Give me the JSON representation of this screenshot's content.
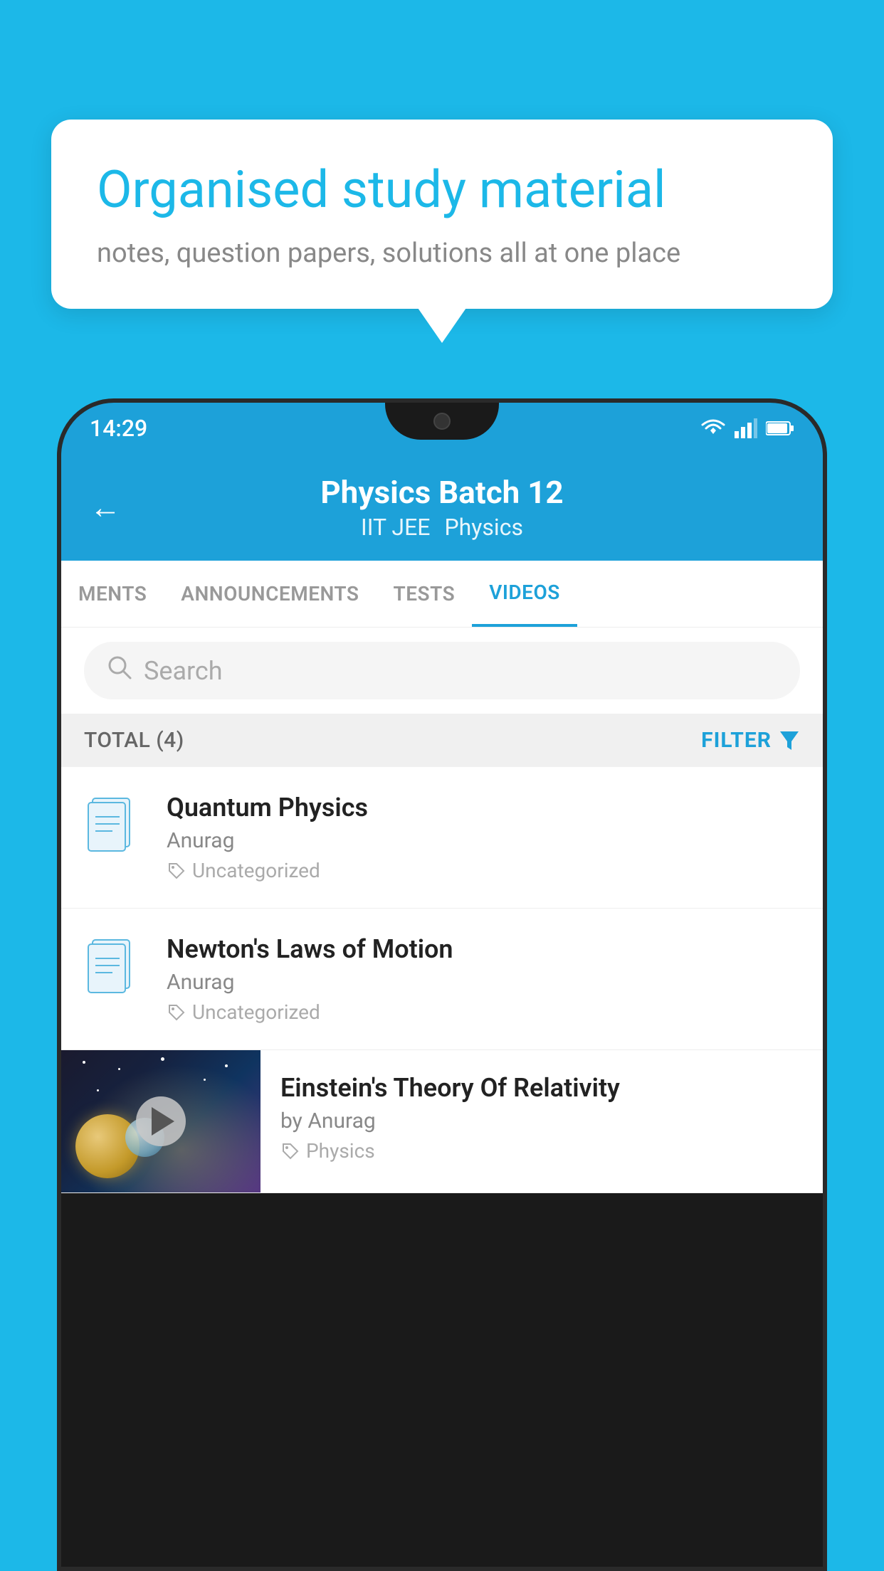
{
  "background_color": "#1CB8E8",
  "speech_bubble": {
    "title": "Organised study material",
    "subtitle": "notes, question papers, solutions all at one place"
  },
  "status_bar": {
    "time": "14:29"
  },
  "app_header": {
    "title": "Physics Batch 12",
    "subtitle_left": "IIT JEE",
    "subtitle_right": "Physics",
    "back_label": "←"
  },
  "tabs": [
    {
      "label": "MENTS",
      "active": false
    },
    {
      "label": "ANNOUNCEMENTS",
      "active": false
    },
    {
      "label": "TESTS",
      "active": false
    },
    {
      "label": "VIDEOS",
      "active": true
    }
  ],
  "search": {
    "placeholder": "Search"
  },
  "filter_bar": {
    "total": "TOTAL (4)",
    "filter_label": "FILTER"
  },
  "videos": [
    {
      "title": "Quantum Physics",
      "author": "Anurag",
      "tag": "Uncategorized",
      "has_thumb": false
    },
    {
      "title": "Newton's Laws of Motion",
      "author": "Anurag",
      "tag": "Uncategorized",
      "has_thumb": false
    },
    {
      "title": "Einstein's Theory Of Relativity",
      "author": "by Anurag",
      "tag": "Physics",
      "has_thumb": true
    }
  ]
}
